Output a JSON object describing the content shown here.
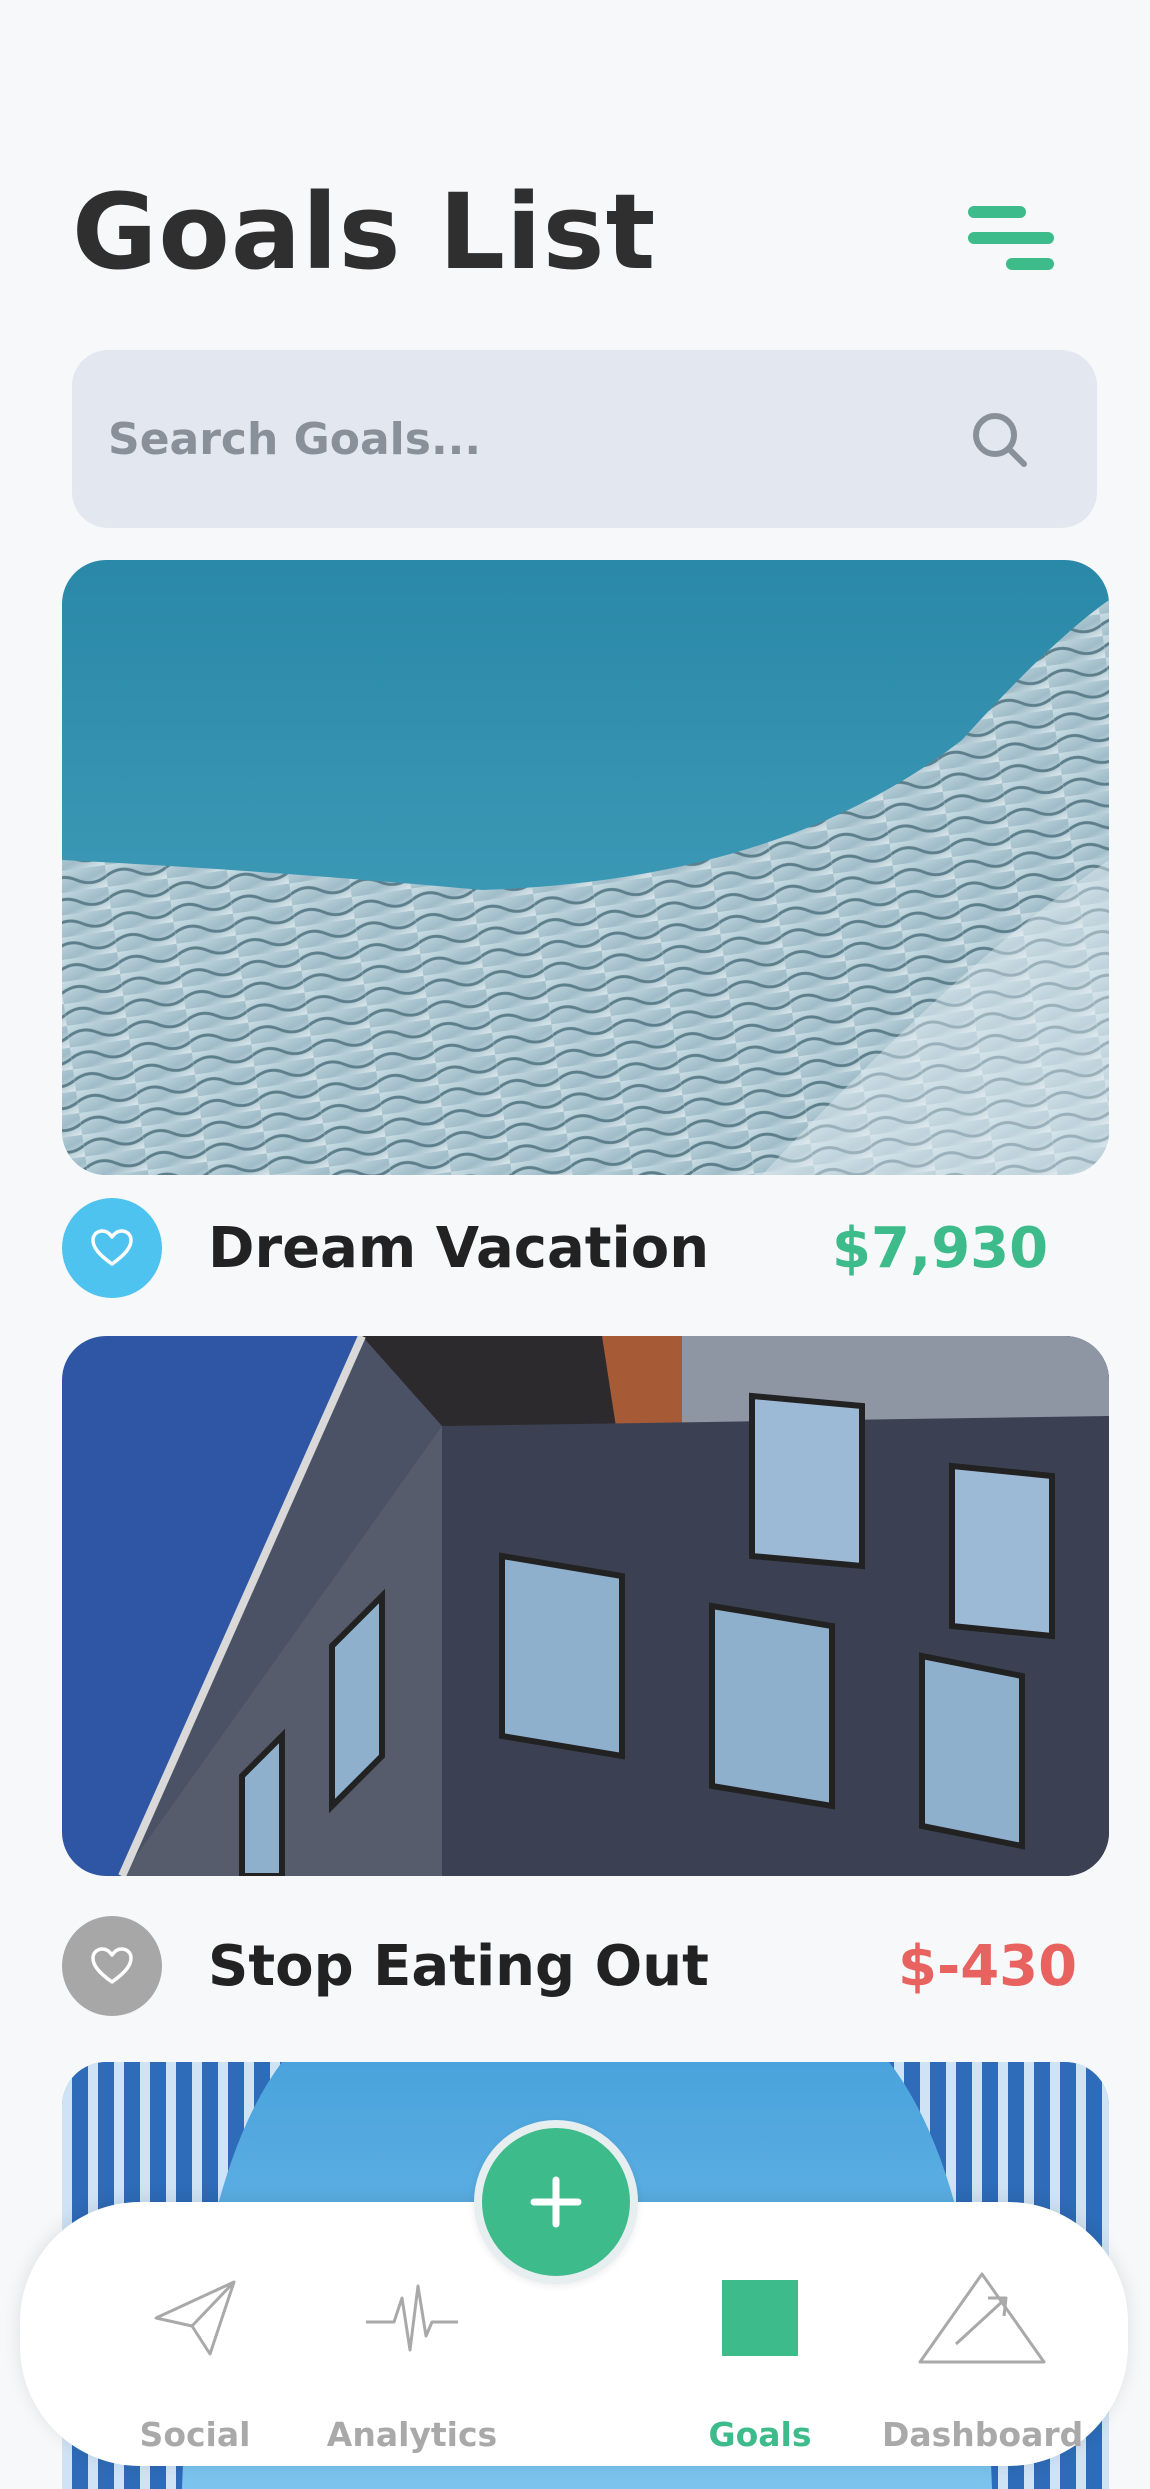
{
  "header": {
    "title": "Goals List"
  },
  "icons": {
    "menu": "menu-lines-icon",
    "search": "search-icon",
    "heart": "heart-icon",
    "add": "plus-icon"
  },
  "search": {
    "placeholder": "Search Goals..."
  },
  "goals": [
    {
      "name": "Dream Vacation",
      "amount": "$7,930",
      "amount_color": "#3dbb8a",
      "favorited": true,
      "heart_color": "#4fc3f0"
    },
    {
      "name": "Stop Eating Out",
      "amount": "$-430",
      "amount_color": "#e8625f",
      "favorited": false,
      "heart_color": "#a7a7a7"
    }
  ],
  "nav": {
    "items": [
      {
        "label": "Social",
        "icon": "paper-plane-icon",
        "active": false
      },
      {
        "label": "Analytics",
        "icon": "pulse-icon",
        "active": false
      },
      {
        "label": "Goals",
        "icon": "square-icon",
        "active": true
      },
      {
        "label": "Dashboard",
        "icon": "triangle-arrow-icon",
        "active": false
      }
    ]
  },
  "colors": {
    "accent": "#3dbb8a",
    "negative": "#e8625f",
    "background": "#f7f8fa",
    "search_bg": "#e3e7ef"
  }
}
